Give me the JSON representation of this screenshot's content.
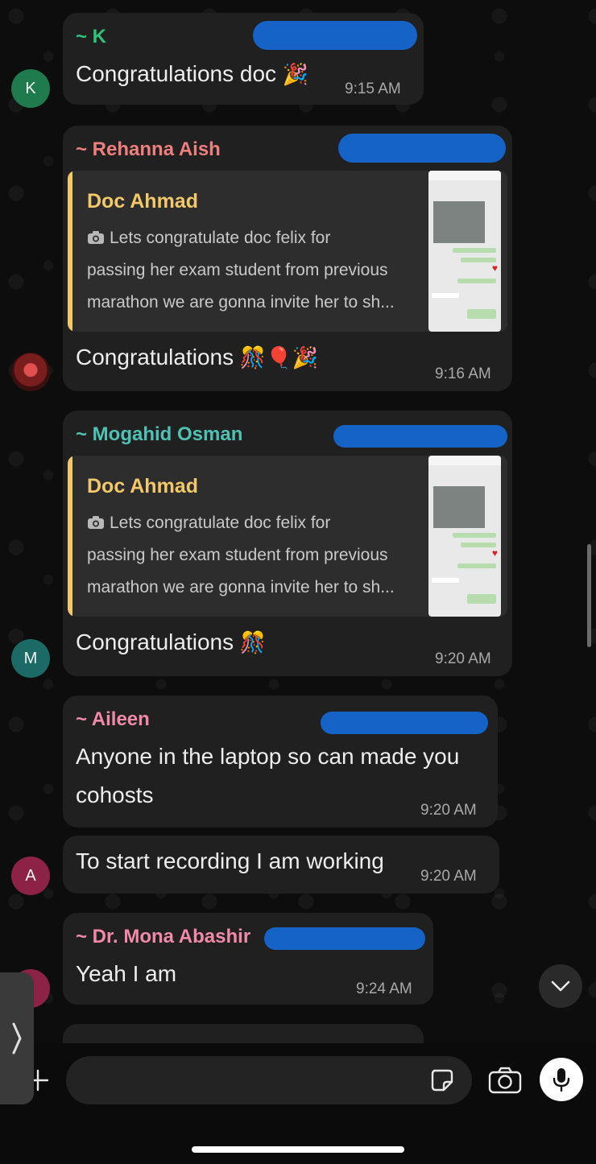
{
  "messages": [
    {
      "sender": "~ K",
      "text": "Congratulations doc",
      "emoji": "🎉",
      "time": "9:15 AM"
    },
    {
      "sender": "~ Rehanna Aish",
      "quote": {
        "author": "Doc Ahmad",
        "lines": [
          "Lets congratulate doc felix for",
          "passing her exam student from previous",
          "marathon we are gonna invite her to sh..."
        ]
      },
      "text": "Congratulations",
      "emoji": "🎊🎈🎉",
      "time": "9:16 AM"
    },
    {
      "sender": "~ Mogahid Osman",
      "quote": {
        "author": "Doc Ahmad",
        "lines": [
          "Lets congratulate doc felix for",
          "passing her exam student from previous",
          "marathon we are gonna invite her to sh..."
        ]
      },
      "text": "Congratulations",
      "emoji": "🎊",
      "time": "9:20 AM",
      "avatar_initial": "M"
    },
    {
      "sender": "~ Aileen",
      "text_line1": "Anyone in the laptop so can made you",
      "text_line2": "cohosts",
      "time": "9:20 AM"
    },
    {
      "text": "To start recording I am working",
      "time": "9:20 AM",
      "avatar_initial": "A"
    },
    {
      "sender": "~ Dr. Mona Abashir",
      "text": "Yeah I am",
      "time": "9:24 AM"
    }
  ],
  "avatars": {
    "k": "K"
  },
  "colors": {
    "sender_k": "#2fc47a",
    "sender_rehanna": "#ee7f7f",
    "sender_mogahid": "#4fc1b3",
    "sender_aileen": "#f08aa8",
    "sender_mona": "#f08aa8",
    "redaction": "#1663c7",
    "quote_author": "#f2c86a"
  },
  "icons": {
    "quote_media": "camera-icon",
    "sticker": "sticker-icon",
    "camera": "camera-icon",
    "mic": "microphone-icon",
    "scroll_down": "chevron-down-icon",
    "attach": "plus-icon",
    "side_tab": "chevron-right-icon"
  }
}
